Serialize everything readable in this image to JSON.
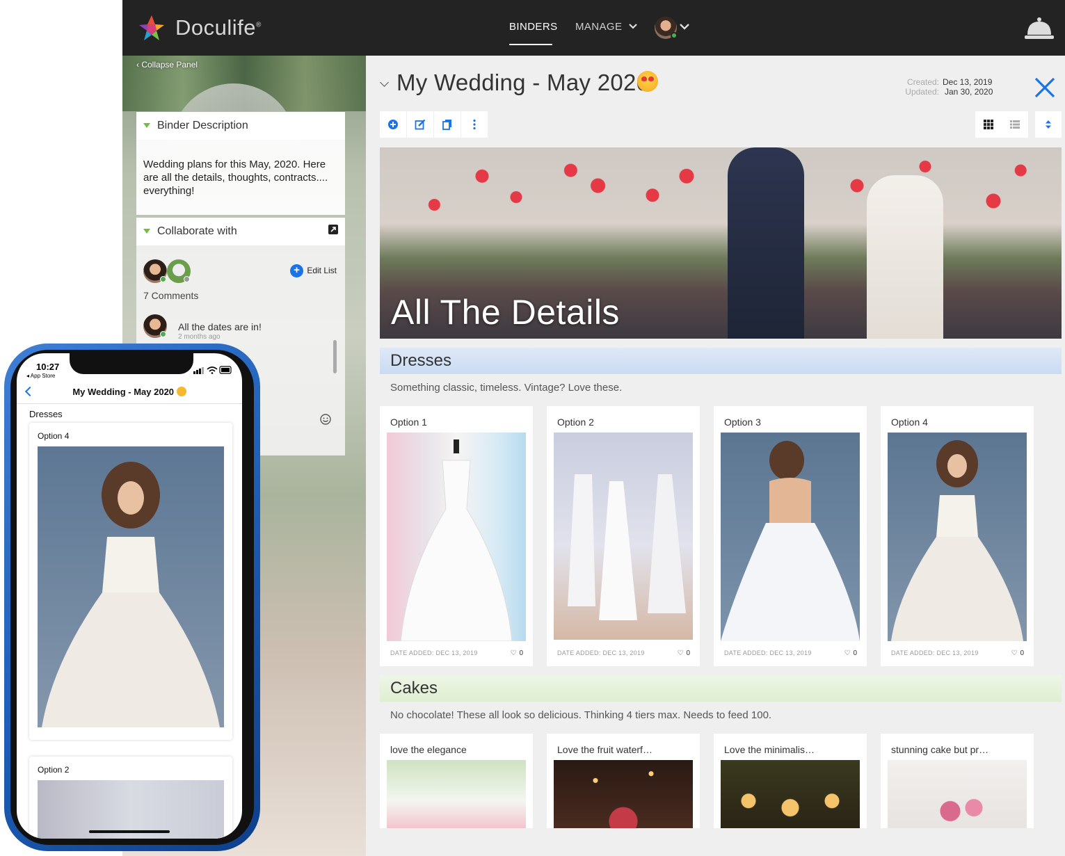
{
  "app": {
    "name": "Doculife",
    "trademark": "®"
  },
  "nav": {
    "binders": "BINDERS",
    "manage": "MANAGE"
  },
  "panel": {
    "collapse": "Collapse Panel",
    "description": {
      "title": "Binder Description",
      "text": "Wedding plans for this May, 2020. Here are all the details, thoughts, contracts.... everything!"
    },
    "collaborate": {
      "title": "Collaborate with",
      "edit_list": "Edit List",
      "comments_count": "7 Comments",
      "comment": {
        "text": "All the dates are in!",
        "time": "2 months ago"
      }
    }
  },
  "binder": {
    "title": "My Wedding - May 2020",
    "created_label": "Created:",
    "created": "Dec 13, 2019",
    "updated_label": "Updated:",
    "updated": "Jan 30, 2020",
    "hero_title": "All The Details"
  },
  "sections": [
    {
      "title": "Dresses",
      "description": "Something classic, timeless. Vintage? Love these.",
      "items": [
        {
          "label": "Option 1",
          "date": "DATE ADDED: DEC 13, 2019",
          "likes": "0"
        },
        {
          "label": "Option 2",
          "date": "DATE ADDED: DEC 13, 2019",
          "likes": "0"
        },
        {
          "label": "Option 3",
          "date": "DATE ADDED: DEC 13, 2019",
          "likes": "0"
        },
        {
          "label": "Option 4",
          "date": "DATE ADDED: DEC 13, 2019",
          "likes": "0"
        }
      ]
    },
    {
      "title": "Cakes",
      "description": "No chocolate! These all look so delicious. Thinking 4 tiers max. Needs to feed 100.",
      "items": [
        {
          "label": "love the elegance"
        },
        {
          "label": "Love the fruit waterf…"
        },
        {
          "label": "Love the minimalis…"
        },
        {
          "label": "stunning cake but pr…"
        }
      ]
    }
  ],
  "phone": {
    "time": "10:27",
    "back_app": "◂ App Store",
    "title": "My Wedding - May 2020",
    "section": "Dresses",
    "card1_label": "Option 4",
    "card2_label": "Option 2"
  },
  "colors": {
    "topbar": "#232323",
    "accent": "#1a73e8",
    "dresses_band": "#cfe0f5",
    "cakes_band": "#e4f0d8",
    "presence": "#4caf50"
  }
}
